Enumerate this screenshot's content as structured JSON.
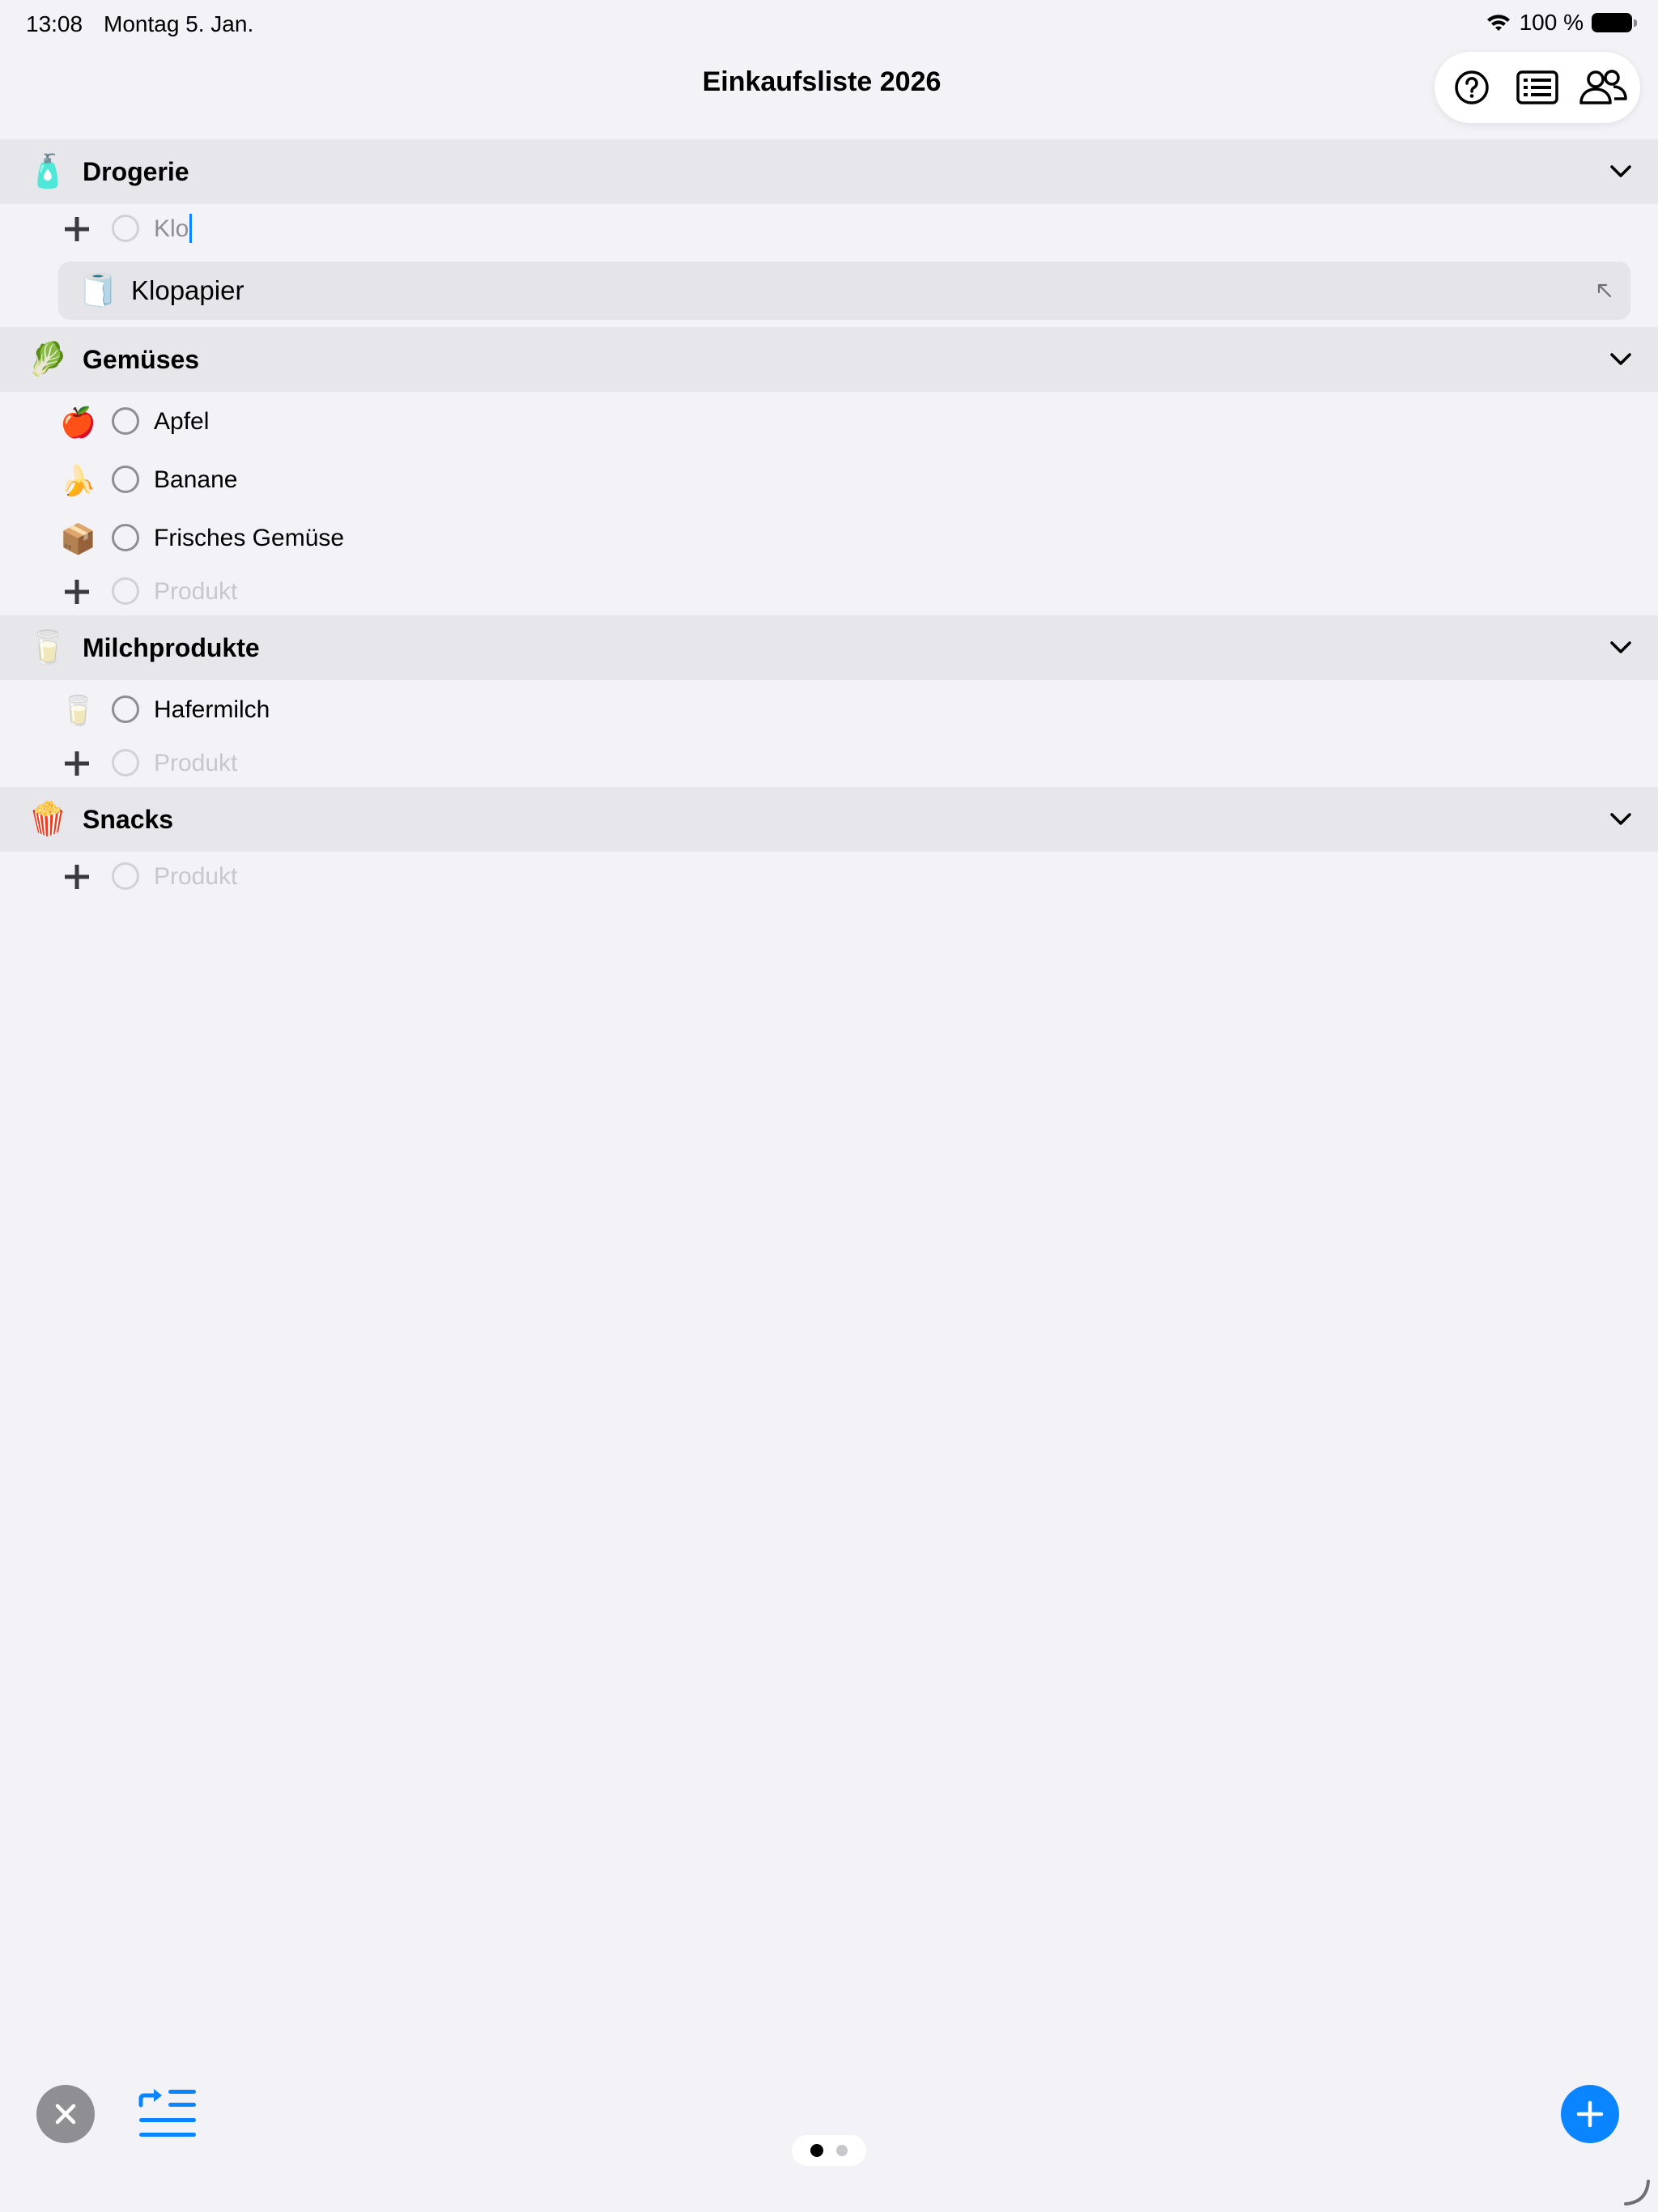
{
  "statusbar": {
    "time": "13:08",
    "date": "Montag 5. Jan.",
    "battery": "100 %"
  },
  "nav": {
    "title": "Einkaufsliste 2026",
    "icons": [
      "help-icon",
      "list-icon",
      "people-icon"
    ]
  },
  "sections": {
    "drogerie": {
      "emoji": "🧴",
      "title": "Drogerie",
      "new_item_value": "Klo",
      "suggestion": {
        "emoji": "🧻",
        "label": "Klopapier"
      }
    },
    "gemuese": {
      "emoji": "🥬",
      "title": "Gemüses",
      "items": [
        {
          "emoji": "🍎",
          "label": "Apfel"
        },
        {
          "emoji": "🍌",
          "label": "Banane"
        },
        {
          "emoji": "📦",
          "label": "Frisches Gemüse"
        }
      ],
      "placeholder": "Produkt"
    },
    "milch": {
      "emoji": "🥛",
      "title": "Milchprodukte",
      "items": [
        {
          "emoji": "🥛",
          "label": "Hafermilch"
        }
      ],
      "placeholder": "Produkt"
    },
    "snacks": {
      "emoji": "🍿",
      "title": "Snacks",
      "placeholder": "Produkt"
    }
  },
  "colors": {
    "accent": "#0a84ff",
    "background": "#f2f2f7",
    "section_header": "#e6e6eb",
    "close_button": "#8e8e93"
  }
}
